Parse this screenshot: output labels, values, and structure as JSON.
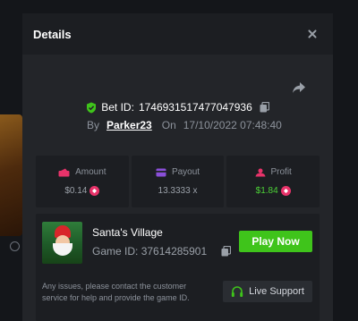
{
  "modal": {
    "title": "Details"
  },
  "bet": {
    "id_label": "Bet ID:",
    "id_value": "1746931517477047936",
    "by_label": "By",
    "username": "Parker23",
    "on_label": "On",
    "datetime": "17/10/2022 07:48:40"
  },
  "stats": [
    {
      "label": "Amount",
      "value": "$0.14",
      "icon": "amount-icon",
      "color": "#e8336a"
    },
    {
      "label": "Payout",
      "value": "13.3333 x",
      "icon": "payout-icon",
      "color": "#8a4fd8"
    },
    {
      "label": "Profit",
      "value": "$1.84",
      "icon": "profit-icon",
      "color": "#e8336a"
    }
  ],
  "game": {
    "name": "Santa's Village",
    "id_label": "Game ID:",
    "id_value": "37614285901",
    "thumb_text": "SANTA'S VILLAGE",
    "play_label": "Play Now"
  },
  "support": {
    "text": "Any issues, please contact the customer service for help and provide the game ID.",
    "button_label": "Live Support"
  },
  "colors": {
    "accent_green": "#3fc41b",
    "profit_green": "#4cd137",
    "coin_pink": "#e8336a",
    "payout_purple": "#8a4fd8"
  }
}
